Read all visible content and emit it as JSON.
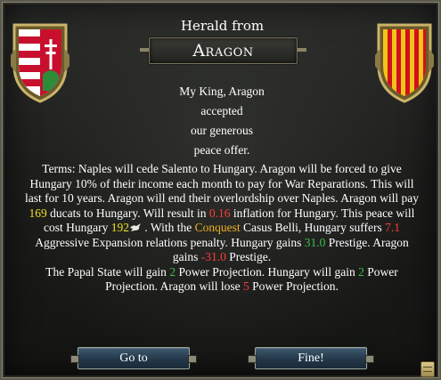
{
  "dialog": {
    "header": "Herald from",
    "title": "Aragon",
    "lead_lines": [
      "My King, Aragon",
      "accepted",
      "our generous",
      "peace offer."
    ],
    "terms": {
      "t1": "Terms: Naples will cede Salento to Hungary. Aragon will be forced to give Hungary 10% of their income each month to pay for War Reparations. This will last for 10 years. Aragon will end their overlordship over Naples.  Aragon will pay ",
      "ducats": "169",
      "t2": " ducats to Hungary. Will result in ",
      "inflation": "0.16",
      "t3": " inflation for Hungary. This peace will cost Hungary ",
      "peace_cost": "192",
      "t4": " . With the ",
      "casus_belli": "Conquest",
      "t5": " Casus Belli, Hungary suffers ",
      "ae": "7.1",
      "t6": " Aggressive Expansion relations penalty. Hungary gains ",
      "prestige_gain": "31.0",
      "t7": " Prestige. Aragon gains ",
      "prestige_loss": "-31.0",
      "t8": " Prestige.",
      "t9": "The Papal State will gain ",
      "papal_pp": "2",
      "t10": " Power Projection. Hungary will gain ",
      "hungary_pp": "2",
      "t11": " Power Projection. Aragon will lose ",
      "aragon_pp": "5",
      "t12": " Power Projection."
    },
    "buttons": {
      "goto": "Go to",
      "fine": "Fine!"
    },
    "icons": {
      "left_shield": "hungary-coat-of-arms-icon",
      "right_shield": "aragon-coat-of-arms-icon",
      "dove": "peace-dove-icon",
      "log": "message-log-icon"
    },
    "colors": {
      "yellow": "#f0e020",
      "red": "#ff3b3b",
      "green": "#39c24a",
      "orange": "#f0b020"
    }
  }
}
